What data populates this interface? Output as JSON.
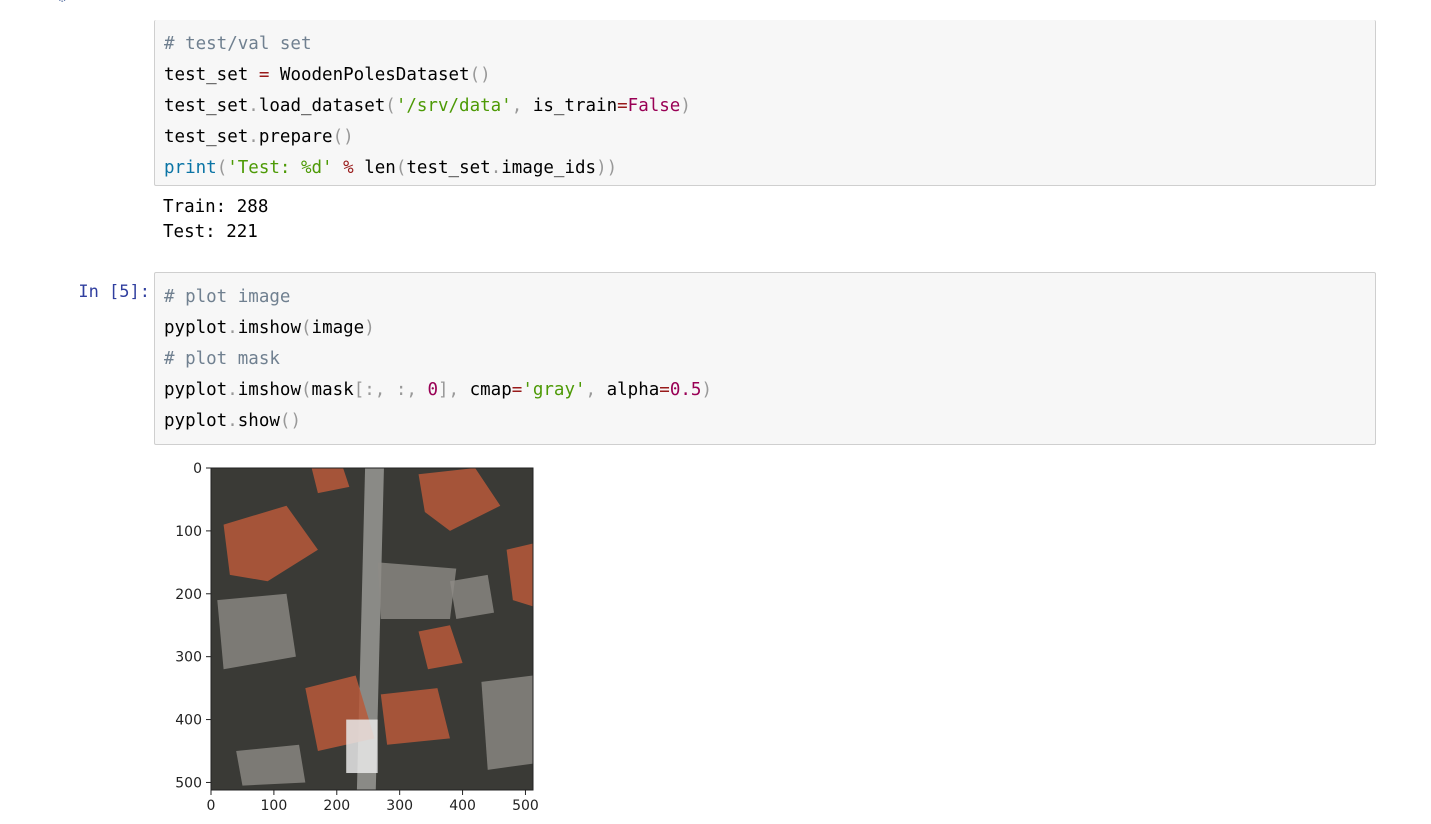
{
  "cells": {
    "cell4": {
      "lines": [
        [
          {
            "t": "# test/val set",
            "c": "cm-comment"
          }
        ],
        [
          {
            "t": "test_set ",
            "c": ""
          },
          {
            "t": "=",
            "c": "cm-op"
          },
          {
            "t": " WoodenPolesDataset",
            "c": ""
          },
          {
            "t": "()",
            "c": "cm-punct"
          }
        ],
        [
          {
            "t": "test_set",
            "c": ""
          },
          {
            "t": ".",
            "c": "cm-punct"
          },
          {
            "t": "load_dataset",
            "c": ""
          },
          {
            "t": "(",
            "c": "cm-punct"
          },
          {
            "t": "'/srv/data'",
            "c": "cm-string"
          },
          {
            "t": ", ",
            "c": "cm-punct"
          },
          {
            "t": "is_train",
            "c": ""
          },
          {
            "t": "=",
            "c": "cm-op"
          },
          {
            "t": "False",
            "c": "cm-const"
          },
          {
            "t": ")",
            "c": "cm-punct"
          }
        ],
        [
          {
            "t": "test_set",
            "c": ""
          },
          {
            "t": ".",
            "c": "cm-punct"
          },
          {
            "t": "prepare",
            "c": ""
          },
          {
            "t": "()",
            "c": "cm-punct"
          }
        ],
        [
          {
            "t": "print",
            "c": "cm-keyword-builtin"
          },
          {
            "t": "(",
            "c": "cm-punct"
          },
          {
            "t": "'Test: %d'",
            "c": "cm-string"
          },
          {
            "t": " ",
            "c": ""
          },
          {
            "t": "%",
            "c": "cm-op"
          },
          {
            "t": " len",
            "c": ""
          },
          {
            "t": "(",
            "c": "cm-punct"
          },
          {
            "t": "test_set",
            "c": ""
          },
          {
            "t": ".",
            "c": "cm-punct"
          },
          {
            "t": "image_ids",
            "c": ""
          },
          {
            "t": "))",
            "c": "cm-punct"
          }
        ]
      ],
      "output": [
        "Train: 288",
        "Test: 221"
      ]
    },
    "cell5": {
      "prompt": "In [5]:",
      "lines": [
        [
          {
            "t": "# plot image",
            "c": "cm-comment"
          }
        ],
        [
          {
            "t": "pyplot",
            "c": ""
          },
          {
            "t": ".",
            "c": "cm-punct"
          },
          {
            "t": "imshow",
            "c": ""
          },
          {
            "t": "(",
            "c": "cm-punct"
          },
          {
            "t": "image",
            "c": ""
          },
          {
            "t": ")",
            "c": "cm-punct"
          }
        ],
        [
          {
            "t": "# plot mask",
            "c": "cm-comment"
          }
        ],
        [
          {
            "t": "pyplot",
            "c": ""
          },
          {
            "t": ".",
            "c": "cm-punct"
          },
          {
            "t": "imshow",
            "c": ""
          },
          {
            "t": "(",
            "c": "cm-punct"
          },
          {
            "t": "mask",
            "c": ""
          },
          {
            "t": "[:, :, ",
            "c": "cm-punct"
          },
          {
            "t": "0",
            "c": "cm-number"
          },
          {
            "t": "], ",
            "c": "cm-punct"
          },
          {
            "t": "cmap",
            "c": ""
          },
          {
            "t": "=",
            "c": "cm-op"
          },
          {
            "t": "'gray'",
            "c": "cm-string"
          },
          {
            "t": ", ",
            "c": "cm-punct"
          },
          {
            "t": "alpha",
            "c": ""
          },
          {
            "t": "=",
            "c": "cm-op"
          },
          {
            "t": "0.5",
            "c": "cm-number"
          },
          {
            "t": ")",
            "c": "cm-punct"
          }
        ],
        [
          {
            "t": "pyplot",
            "c": ""
          },
          {
            "t": ".",
            "c": "cm-punct"
          },
          {
            "t": "show",
            "c": ""
          },
          {
            "t": "()",
            "c": "cm-punct"
          }
        ]
      ]
    }
  },
  "plot": {
    "xticks": [
      "0",
      "100",
      "200",
      "300",
      "400",
      "500"
    ],
    "yticks": [
      "0",
      "100",
      "200",
      "300",
      "400",
      "500"
    ],
    "xtick_values": [
      0,
      100,
      200,
      300,
      400,
      500
    ],
    "ytick_values": [
      0,
      100,
      200,
      300,
      400,
      500
    ],
    "extent": [
      0,
      512
    ],
    "mask_region": {
      "x0": 215,
      "x1": 265,
      "y0": 400,
      "y1": 485
    },
    "colors": {
      "background": "#3a3a36",
      "roof": "#b8593a",
      "road": "#8a8a86",
      "mask": "#e8e8e8"
    }
  }
}
